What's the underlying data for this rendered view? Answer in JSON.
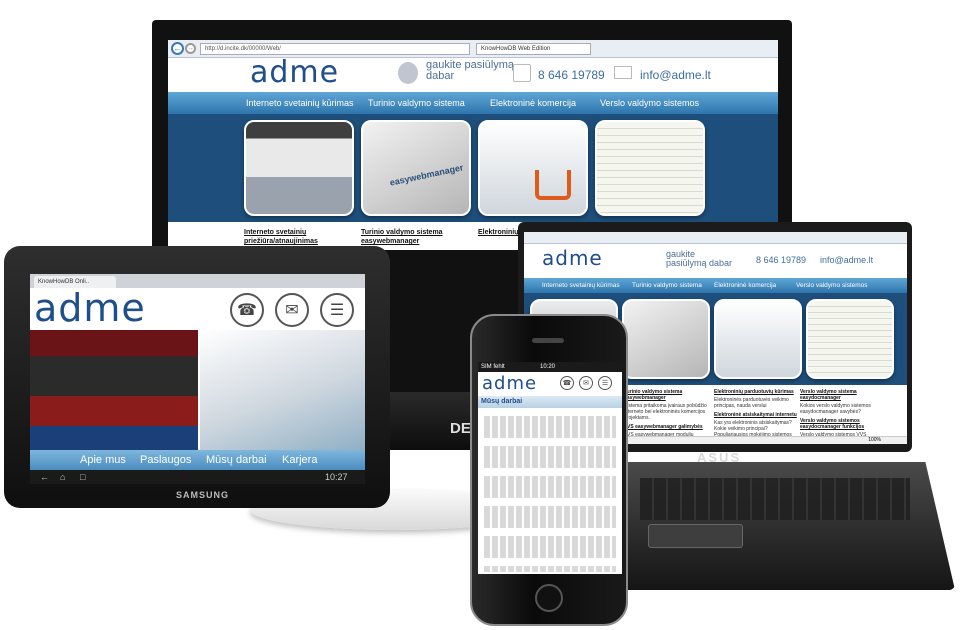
{
  "monitor": {
    "url": "http://d.incite.dk/00000/Web/",
    "tab_title": "KnowHowDB Web Edition",
    "logo": "adme",
    "cta": "gaukite pasiūlymą dabar",
    "phone": "8 646 19789",
    "email": "info@adme.lt",
    "nav": [
      "Interneto svetainių kūrimas",
      "Turinio valdymo sistema",
      "Elektroninė komercija",
      "Verslo valdymo sistemos"
    ],
    "links": [
      {
        "title": "Interneto svetainių priežiūra/atnaujinimas"
      },
      {
        "title": "Turinio valdymo sistema easywebmanager"
      },
      {
        "title": "Elektroninių"
      }
    ],
    "brand": "DELL",
    "thumb_label": "easywebmanager"
  },
  "laptop": {
    "logo": "adme",
    "cta": "gaukite pasiūlymą dabar",
    "phone": "8 646 19789",
    "email": "info@adme.lt",
    "nav": [
      "Interneto svetainių kūrimas",
      "Turinio valdymo sistema",
      "Elektroninė komercija",
      "Verslo valdymo sistemos"
    ],
    "col1": [
      {
        "title": "Turinio valdymo sistema easywebmanager",
        "text": "Sistema pritaikoma įvairaus pobūdžio interneto bei elektroninės komercijos projektams."
      },
      {
        "title": "TVS easywebmanager galimybės",
        "text": "TVS easywebmanager modulių"
      }
    ],
    "col2": [
      {
        "title": "Elektroninių parduotuvių kūrimas",
        "text": "Elektroninės parduotuvės veikimo principas, nauda verslui"
      },
      {
        "title": "Elektroninė atsiskaitymai internetu",
        "text": "Kas yra elektroninis atsiskaitymas? Kokie veikimo principai? Populiariausios mokėjimo sistemos"
      }
    ],
    "col3": [
      {
        "title": "Verslo valdymo sistema easydocmanager",
        "text": "Kokios verslo valdymo sistemos easydocmanager savybės?"
      },
      {
        "title": "Verslo valdymo sistemos easydocmanager funkcijos",
        "text": "Verslo valdymo sistemos VVS"
      }
    ],
    "zoom": "100%",
    "brand": "ASUS"
  },
  "tablet": {
    "tab_title": "KnowHowDB Onli..",
    "logo": "adme",
    "nav": [
      "Apie mus",
      "Paslaugos",
      "Mūsų darbai",
      "Karjera"
    ],
    "time": "10:27",
    "brand": "SAMSUNG"
  },
  "phone": {
    "carrier": "SIM fehlt",
    "time": "10:20",
    "logo": "adme",
    "section": "Mūsų darbai"
  }
}
